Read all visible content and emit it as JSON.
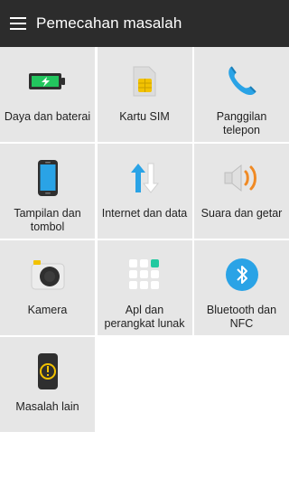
{
  "appbar": {
    "title": "Pemecahan masalah",
    "menu_icon": "hamburger-menu-icon"
  },
  "tiles": [
    {
      "label": "Daya dan baterai",
      "icon": "battery-charging-icon"
    },
    {
      "label": "Kartu SIM",
      "icon": "sim-card-icon"
    },
    {
      "label": "Panggilan telepon",
      "icon": "phone-handset-icon"
    },
    {
      "label": "Tampilan dan tombol",
      "icon": "smartphone-icon"
    },
    {
      "label": "Internet dan data",
      "icon": "data-arrows-icon"
    },
    {
      "label": "Suara dan getar",
      "icon": "speaker-vibrate-icon"
    },
    {
      "label": "Kamera",
      "icon": "camera-icon"
    },
    {
      "label": "Apl dan perangkat lunak",
      "icon": "app-grid-icon"
    },
    {
      "label": "Bluetooth dan NFC",
      "icon": "bluetooth-icon"
    },
    {
      "label": "Masalah lain",
      "icon": "warning-phone-icon"
    }
  ],
  "colors": {
    "appbar": "#2c2c2c",
    "tile_bg": "#e6e6e6",
    "accent_blue": "#2aa3e6",
    "accent_green": "#22c55e",
    "accent_orange": "#f08a24",
    "accent_yellow": "#f2c200"
  }
}
